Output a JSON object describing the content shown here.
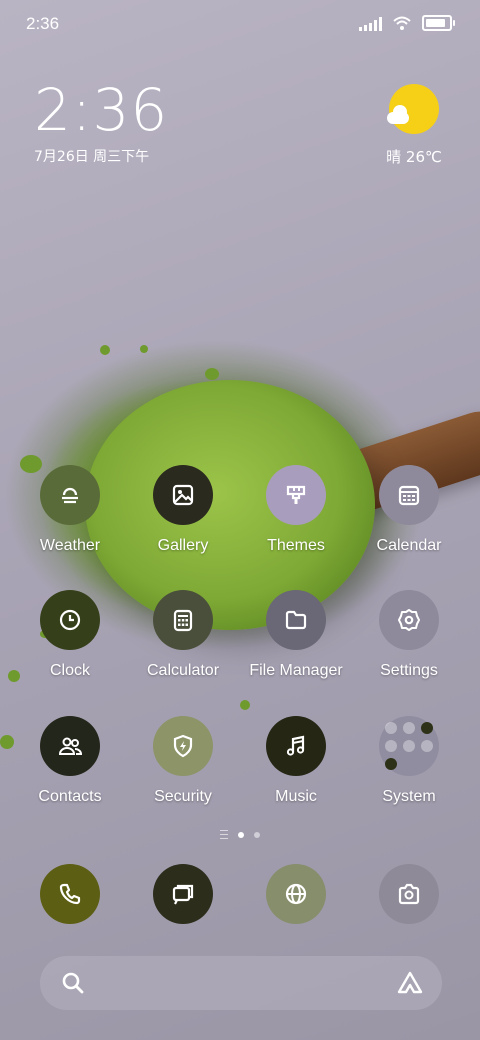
{
  "status_bar": {
    "time": "2:36"
  },
  "clock_widget": {
    "time": "2:36",
    "date": "7月26日 周三下午"
  },
  "weather_widget": {
    "condition": "晴",
    "temperature": "26℃",
    "icon": "sunny-cloud-icon"
  },
  "apps": [
    {
      "label": "Weather",
      "icon": "weather-fog-icon",
      "color": "#5a6b3a"
    },
    {
      "label": "Gallery",
      "icon": "gallery-icon",
      "color": "#2b2a1f"
    },
    {
      "label": "Themes",
      "icon": "brush-icon",
      "color": "#a99dbe"
    },
    {
      "label": "Calendar",
      "icon": "calendar-icon",
      "color": "#8f8a9b"
    },
    {
      "label": "Clock",
      "icon": "clock-icon",
      "color": "#35401a"
    },
    {
      "label": "Calculator",
      "icon": "calculator-icon",
      "color": "#4a4f3b"
    },
    {
      "label": "File Manager",
      "icon": "folder-icon",
      "color": "#6a6776"
    },
    {
      "label": "Settings",
      "icon": "gear-icon",
      "color": "#8f8a9b"
    },
    {
      "label": "Contacts",
      "icon": "contacts-icon",
      "color": "#23261a"
    },
    {
      "label": "Security",
      "icon": "shield-bolt-icon",
      "color": "#8c9468"
    },
    {
      "label": "Music",
      "icon": "music-note-icon",
      "color": "#262615"
    },
    {
      "label": "System",
      "icon": "folder-grid-icon",
      "color": "#918da0"
    }
  ],
  "page_indicator": {
    "pages": 2,
    "current": 1
  },
  "dock": [
    {
      "name": "Phone",
      "icon": "phone-icon",
      "color": "#5c5e14"
    },
    {
      "name": "Messages",
      "icon": "messages-icon",
      "color": "#2d2d1c"
    },
    {
      "name": "Browser",
      "icon": "globe-icon",
      "color": "#878e6c"
    },
    {
      "name": "Camera",
      "icon": "camera-icon",
      "color": "#8e8a98"
    }
  ],
  "search_bar": {
    "left_icon": "search-icon",
    "right_icon": "assistant-icon"
  }
}
